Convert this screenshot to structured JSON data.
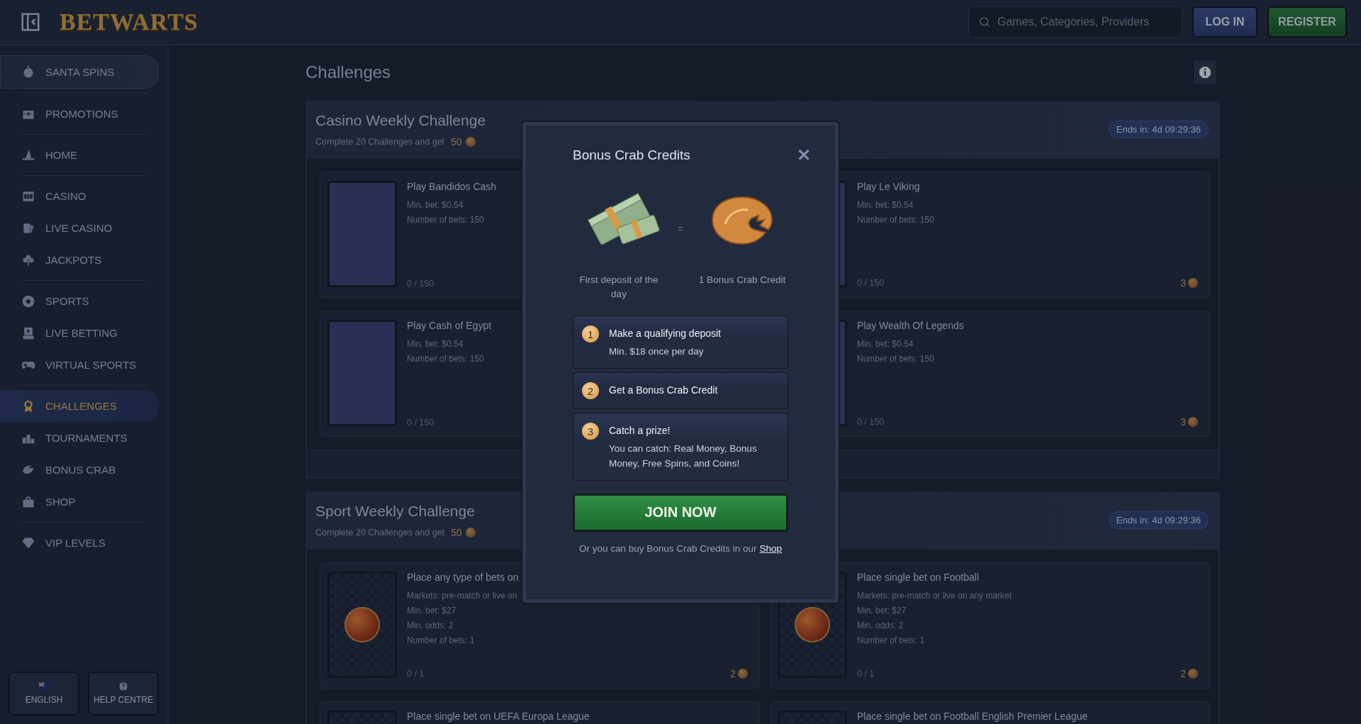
{
  "header": {
    "logo": "BETWARTS",
    "search": {
      "placeholder": "Games, Categories, Providers"
    },
    "buttons": [
      {
        "label": "LOG IN",
        "kind": "login"
      },
      {
        "label": "REGISTER",
        "kind": "register"
      }
    ]
  },
  "sidebar": {
    "groups": [
      [
        {
          "label": "SANTA SPINS",
          "selected": false,
          "featured": true
        }
      ],
      [
        {
          "label": "PROMOTIONS",
          "selected": false,
          "featured": false
        }
      ],
      [
        {
          "label": "HOME",
          "selected": false,
          "featured": false
        }
      ],
      [
        {
          "label": "CASINO",
          "selected": false,
          "featured": false
        },
        {
          "label": "LIVE CASINO",
          "selected": false,
          "featured": false
        },
        {
          "label": "JACKPOTS",
          "selected": false,
          "featured": false
        }
      ],
      [
        {
          "label": "SPORTS",
          "selected": false,
          "featured": false
        },
        {
          "label": "LIVE BETTING",
          "selected": false,
          "featured": false
        },
        {
          "label": "VIRTUAL SPORTS",
          "selected": false,
          "featured": false
        }
      ],
      [
        {
          "label": "CHALLENGES",
          "selected": true,
          "featured": false
        },
        {
          "label": "TOURNAMENTS",
          "selected": false,
          "featured": false
        },
        {
          "label": "BONUS CRAB",
          "selected": false,
          "featured": false
        },
        {
          "label": "SHOP",
          "selected": false,
          "featured": false
        }
      ],
      [
        {
          "label": "VIP LEVELS",
          "selected": false,
          "featured": false
        }
      ]
    ],
    "footer_buttons": [
      {
        "label": "ENGLISH",
        "kind": "language"
      },
      {
        "label": "HELP CENTRE",
        "kind": "help"
      }
    ]
  },
  "page": {
    "title": "Challenges",
    "sections": [
      {
        "title": "Casino Weekly Challenge",
        "subtitle": "Complete 20 Challenges and get",
        "reward": "50",
        "ends": "Ends in: 4d 09:29:36",
        "cards": [
          {
            "kind": "game",
            "title": "Play Bandidos Cash",
            "details": [
              "Min. bet: $0.54",
              "Number of bets: 150"
            ],
            "progress": "0 / 150"
          },
          {
            "kind": "game",
            "title": "Play Le Viking",
            "details": [
              "Min. bet: $0.54",
              "Number of bets: 150"
            ],
            "progress": "0 / 150",
            "reward": "3"
          },
          {
            "kind": "game",
            "title": "Play Cash of Egypt",
            "details": [
              "Min. bet: $0.54",
              "Number of bets: 150"
            ],
            "progress": "0 / 150"
          },
          {
            "kind": "game",
            "title": "Play Wealth Of Legends",
            "details": [
              "Min. bet: $0.54",
              "Number of bets: 150"
            ],
            "progress": "0 / 150",
            "reward": "3"
          }
        ]
      },
      {
        "title": "Sport Weekly Challenge",
        "subtitle": "Complete 20 Challenges and get",
        "reward": "50",
        "ends": "Ends in: 4d 09:29:36",
        "cards": [
          {
            "kind": "sport",
            "title": "Place any type of bets on",
            "details": [
              "Markets: pre-match or live on",
              "Min. bet: $27",
              "Min. odds: 2",
              "Number of bets: 1"
            ],
            "progress": "0 / 1",
            "reward": "2"
          },
          {
            "kind": "sport",
            "title": "Place single bet on Football",
            "details": [
              "Markets: pre-match or live on any market",
              "Min. bet: $27",
              "Min. odds: 2",
              "Number of bets: 1"
            ],
            "progress": "0 / 1",
            "reward": "2"
          },
          {
            "kind": "sport",
            "title": "Place single bet on UEFA Europa League"
          },
          {
            "kind": "sport",
            "title": "Place single bet on Football English Premier League"
          }
        ]
      }
    ]
  },
  "modal": {
    "title": "Bonus Crab Credits",
    "close": "✕",
    "exchange": {
      "left": "First deposit of the day",
      "equals": "=",
      "right": "1 Bonus Crab Credit"
    },
    "steps": [
      {
        "number": "1",
        "title": "Make a qualifying deposit",
        "text": "Min. $18 once per day"
      },
      {
        "number": "2",
        "title": "Get a Bonus Crab Credit"
      },
      {
        "number": "3",
        "title": "Catch a prize!",
        "text": "You can catch: Real Money, Bonus Money, Free Spins, and Coins!"
      }
    ],
    "button": "JOIN NOW",
    "footer": {
      "text": "Or you can buy Bonus Crab Credits in our",
      "link": "Shop"
    }
  }
}
